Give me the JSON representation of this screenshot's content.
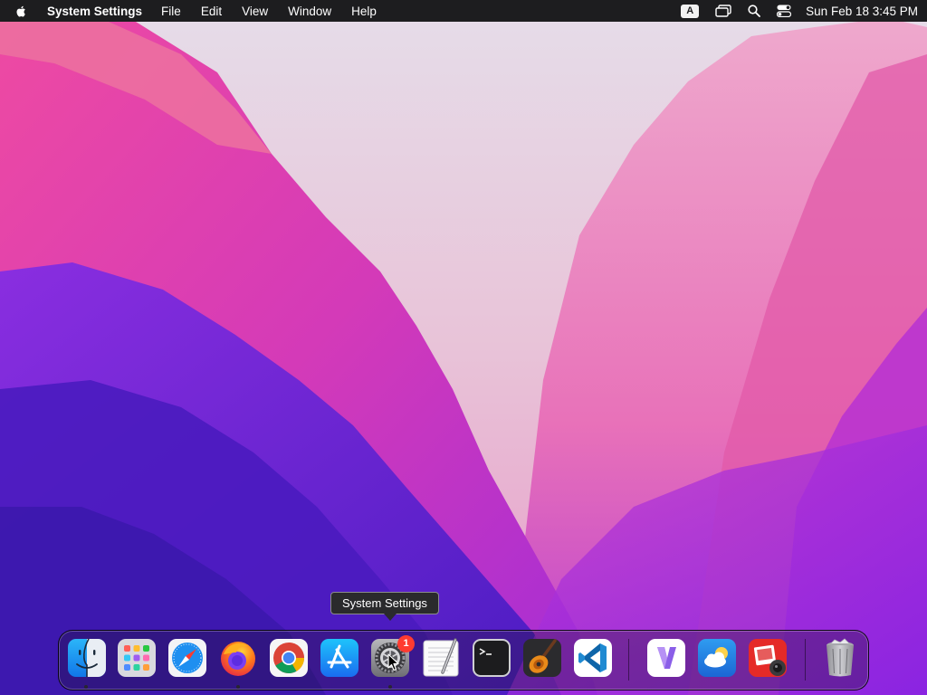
{
  "menubar": {
    "app_name": "System Settings",
    "items": [
      "File",
      "Edit",
      "View",
      "Window",
      "Help"
    ],
    "input_source": "A",
    "clock": "Sun Feb 18  3:45 PM",
    "icons": [
      "apple-icon",
      "keyboard-input-icon",
      "screen-mirroring-icon",
      "search-icon",
      "control-center-icon"
    ]
  },
  "tooltip": {
    "text": "System Settings"
  },
  "dock": {
    "apps": [
      {
        "name": "Finder",
        "icon": "finder-icon",
        "running": true
      },
      {
        "name": "Launchpad",
        "icon": "launchpad-icon",
        "running": false
      },
      {
        "name": "Safari",
        "icon": "safari-icon",
        "running": false
      },
      {
        "name": "Firefox",
        "icon": "firefox-icon",
        "running": true
      },
      {
        "name": "Google Chrome",
        "icon": "chrome-icon",
        "running": false
      },
      {
        "name": "App Store",
        "icon": "app-store-icon",
        "running": false
      },
      {
        "name": "System Settings",
        "icon": "system-settings-icon",
        "running": true,
        "badge": "1"
      },
      {
        "name": "TextEdit",
        "icon": "textedit-icon",
        "running": false
      },
      {
        "name": "Terminal",
        "icon": "terminal-icon",
        "running": false
      },
      {
        "name": "GarageBand",
        "icon": "garageband-icon",
        "running": false
      },
      {
        "name": "Visual Studio Code",
        "icon": "vscode-icon",
        "running": false
      },
      {
        "name": "Visual Studio",
        "icon": "visual-studio-icon",
        "running": false
      },
      {
        "name": "Weather",
        "icon": "weather-icon",
        "running": false
      },
      {
        "name": "Photo Booth",
        "icon": "photo-booth-icon",
        "running": false
      },
      {
        "name": "Trash",
        "icon": "trash-icon",
        "running": false
      }
    ]
  },
  "colors": {
    "menubar_bg": "#1d1d1f",
    "badge": "#ff3b30",
    "wallpaper_pink": "#e23fa6",
    "wallpaper_purple": "#6a24d8"
  }
}
